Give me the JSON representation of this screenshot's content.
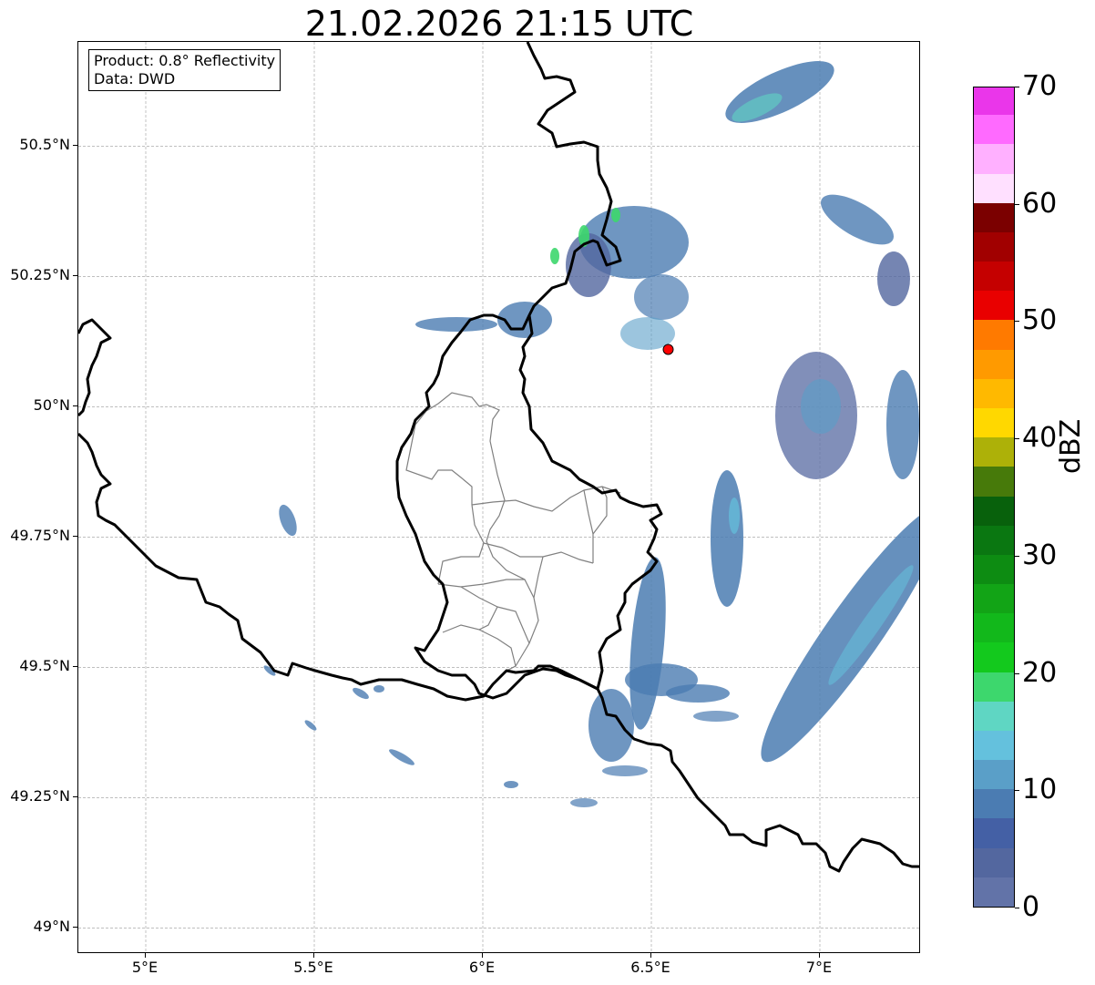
{
  "title": "21.02.2026 21:15 UTC",
  "info": {
    "product": "Product: 0.8° Reflectivity",
    "data": "Data: DWD"
  },
  "map": {
    "lon_range": [
      4.8,
      7.3
    ],
    "lat_range": [
      48.95,
      50.7
    ],
    "x_ticks": [
      "5°E",
      "5.5°E",
      "6°E",
      "6.5°E",
      "7°E"
    ],
    "y_ticks": [
      "50.5°N",
      "50.25°N",
      "50°N",
      "49.75°N",
      "49.5°N",
      "49.25°N",
      "49°N"
    ],
    "gridlines": true,
    "radar_site": {
      "lon": 6.55,
      "lat": 50.11,
      "color": "#ff0000"
    },
    "border_color": "#000000",
    "district_color": "#808080"
  },
  "colorbar": {
    "label": "dBZ",
    "range": [
      0,
      70
    ],
    "tick_labels": [
      "0",
      "10",
      "20",
      "30",
      "40",
      "50",
      "60",
      "70"
    ],
    "colors": [
      "#6273a8",
      "#53679f",
      "#4460a5",
      "#4b7cb2",
      "#5a9fc8",
      "#64c1dd",
      "#5fd6c3",
      "#3dd76d",
      "#13c91d",
      "#12b81b",
      "#12a416",
      "#0d8c12",
      "#0a7711",
      "#08610c",
      "#477a0a",
      "#adb108",
      "#ffd800",
      "#ffb900",
      "#ff9a00",
      "#ff7a00",
      "#e90000",
      "#c50000",
      "#a10000",
      "#7b0000",
      "#ffe0ff",
      "#ffb0ff",
      "#ff6aff",
      "#ea36ea"
    ]
  }
}
